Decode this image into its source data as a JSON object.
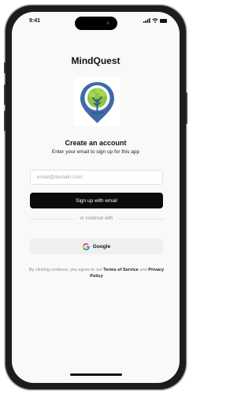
{
  "status_bar": {
    "time": "9:41"
  },
  "app": {
    "title": "MindQuest"
  },
  "signup": {
    "heading": "Create an account",
    "subheading": "Enter your email to sign up for this app",
    "email_placeholder": "email@domain.com",
    "submit_label": "Sign up with email"
  },
  "divider": {
    "label": "or continue with"
  },
  "google": {
    "label": "Google"
  },
  "legal": {
    "prefix": "By clicking continue, you agree to our ",
    "terms_label": "Terms of Service",
    "conjunction": " and ",
    "privacy_label": "Privacy Policy"
  },
  "colors": {
    "primary_button": "#0c0c0e",
    "logo_blue": "#3f6aa8",
    "logo_green": "#8cc63f"
  },
  "icons": {
    "logo": "pin-tree-brain-logo",
    "google": "google-g-icon",
    "signal": "signal-icon",
    "wifi": "wifi-icon",
    "battery": "battery-icon"
  }
}
